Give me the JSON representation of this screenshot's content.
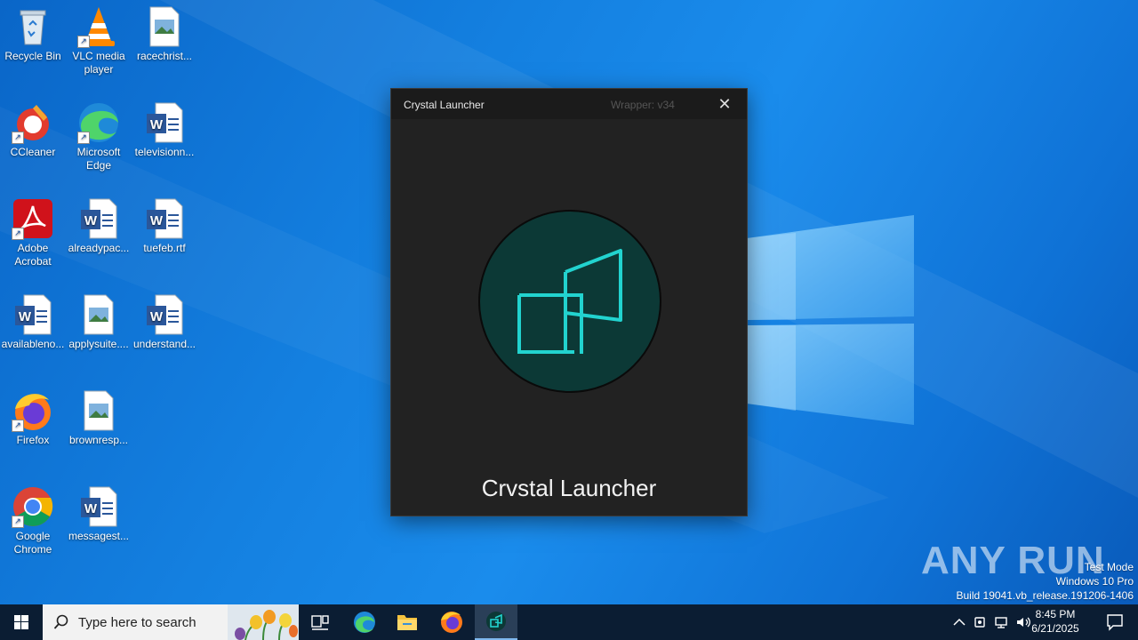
{
  "desktop": {
    "icons": [
      {
        "label": "Recycle Bin",
        "icon": "recycle-bin-icon",
        "kind": "bin",
        "shortcut": false
      },
      {
        "label": "VLC media player",
        "icon": "vlc-icon",
        "kind": "vlc",
        "shortcut": true
      },
      {
        "label": "racechrist...",
        "icon": "image-file-icon",
        "kind": "img",
        "shortcut": false
      },
      {
        "label": "CCleaner",
        "icon": "ccleaner-icon",
        "kind": "ccleaner",
        "shortcut": true
      },
      {
        "label": "Microsoft Edge",
        "icon": "edge-icon",
        "kind": "edge",
        "shortcut": true
      },
      {
        "label": "televisionn...",
        "icon": "word-document-icon",
        "kind": "word",
        "shortcut": false
      },
      {
        "label": "Adobe Acrobat",
        "icon": "acrobat-icon",
        "kind": "acrobat",
        "shortcut": true
      },
      {
        "label": "alreadypac...",
        "icon": "word-document-icon",
        "kind": "word",
        "shortcut": false
      },
      {
        "label": "tuefeb.rtf",
        "icon": "word-document-icon",
        "kind": "word",
        "shortcut": false
      },
      {
        "label": "availableno...",
        "icon": "word-document-icon",
        "kind": "word",
        "shortcut": false
      },
      {
        "label": "applysuite....",
        "icon": "image-file-icon",
        "kind": "img",
        "shortcut": false
      },
      {
        "label": "understand...",
        "icon": "word-document-icon",
        "kind": "word",
        "shortcut": false
      },
      {
        "label": "Firefox",
        "icon": "firefox-icon",
        "kind": "firefox",
        "shortcut": true
      },
      {
        "label": "brownresp...",
        "icon": "image-file-icon",
        "kind": "img",
        "shortcut": false
      },
      {
        "label": "Google Chrome",
        "icon": "chrome-icon",
        "kind": "chrome",
        "shortcut": true
      },
      {
        "label": "messagest...",
        "icon": "word-document-icon",
        "kind": "word",
        "shortcut": false
      }
    ]
  },
  "window": {
    "title": "Crystal Launcher",
    "wrapper": "Wrapper: v34",
    "close_glyph": "✕",
    "app_name": "Crvstal Launcher",
    "logo_icon": "crystal-launcher-logo-icon",
    "accent": "#22d3cf",
    "logo_bg": "#0c3936"
  },
  "watermark": {
    "brand": "ANY RUN",
    "line1": "Test Mode",
    "line2": "Windows 10 Pro",
    "line3": "Build 19041.vb_release.191206-1406"
  },
  "taskbar": {
    "search_placeholder": "Type here to search",
    "apps": [
      "task-view-icon",
      "edge-icon",
      "file-explorer-icon",
      "firefox-icon",
      "crystal-launcher-icon"
    ],
    "clock_time": "8:45 PM",
    "clock_date": "6/21/2025"
  }
}
